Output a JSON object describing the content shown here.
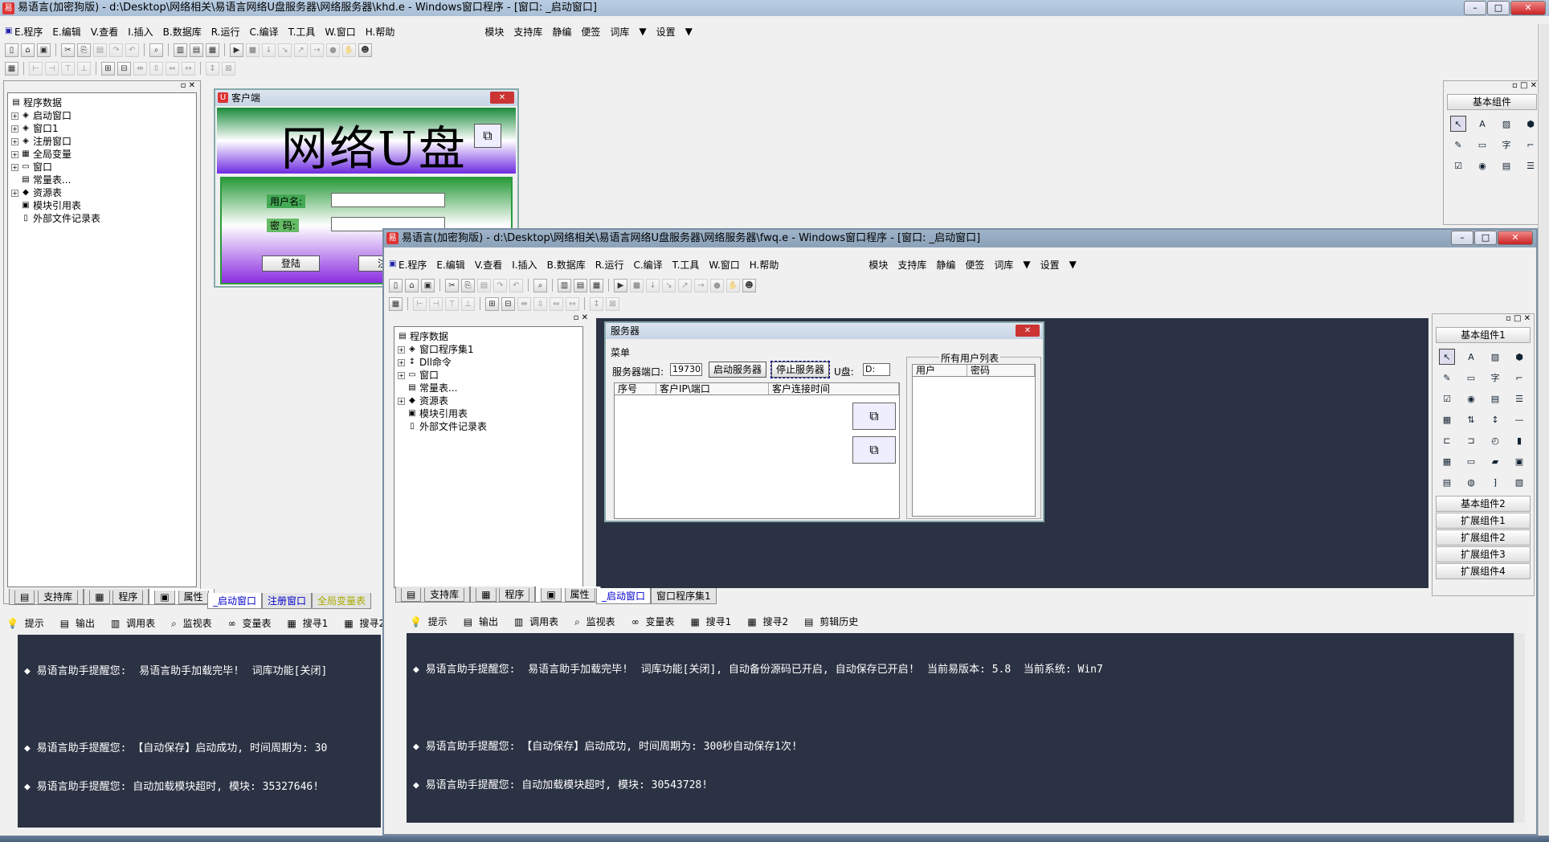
{
  "main_window": {
    "title": "易语言(加密狗版) - d:\\Desktop\\网络相关\\易语言网络U盘服务器\\网络服务器\\khd.e - Windows窗口程序 - [窗口: _启动窗口]"
  },
  "menu": [
    "E.程序",
    "E.编辑",
    "V.查看",
    "I.插入",
    "B.数据库",
    "R.运行",
    "C.编译",
    "T.工具",
    "W.窗口",
    "H.帮助"
  ],
  "menu_extra": [
    "模块",
    "支持库",
    "静编",
    "便签",
    "词库",
    "设置"
  ],
  "tree_left": [
    "程序数据",
    "启动窗口",
    "窗口1",
    "注册窗口",
    "全局变量",
    "窗口",
    "常量表...",
    "资源表",
    "模块引用表",
    "外部文件记录表"
  ],
  "left_tabs": [
    "支持库",
    "程序",
    "属性"
  ],
  "doc_tabs_left": [
    "_启动窗口",
    "注册窗口",
    "全局变量表"
  ],
  "out_tabs": [
    "提示",
    "输出",
    "调用表",
    "监视表",
    "变量表",
    "搜寻1",
    "搜寻2",
    "剪辑历史"
  ],
  "left_output": [
    "◆ 易语言助手提醒您:  易语言助手加载完毕!  词库功能[关闭]",
    "",
    "◆ 易语言助手提醒您: 【自动保存】启动成功, 时间周期为: 30",
    "◆ 易语言助手提醒您: 自动加载模块超时, 模块: 35327646!"
  ],
  "client_form": {
    "title": "客户端",
    "banner": "网络U盘",
    "user_label": "用户名:",
    "pwd_label": "密 码:",
    "login": "登陆",
    "register": "注册"
  },
  "palette_top": {
    "title": "基本组件"
  },
  "second_window": {
    "title": "易语言(加密狗版) - d:\\Desktop\\网络相关\\易语言网络U盘服务器\\网络服务器\\fwq.e - Windows窗口程序 - [窗口: _启动窗口]"
  },
  "tree_right": [
    "程序数据",
    "窗口程序集1",
    "Dll命令",
    "窗口",
    "常量表...",
    "资源表",
    "模块引用表",
    "外部文件记录表"
  ],
  "right_tabs": [
    "支持库",
    "程序",
    "属性"
  ],
  "doc_tabs_right": [
    "_启动窗口",
    "窗口程序集1"
  ],
  "server_form": {
    "title": "服务器",
    "menu": "菜单",
    "port_label": "服务器端口:",
    "port_value": "19730",
    "start": "启动服务器",
    "stop": "停止服务器",
    "udisk_label": "U盘:",
    "udisk_value": "D:",
    "cols": [
      "序号",
      "客户IP\\端口",
      "客户连接时间"
    ],
    "users_title": "所有用户列表",
    "user_cols": [
      "用户",
      "密码"
    ]
  },
  "palette_right": {
    "title": "基本组件1",
    "groups": [
      "基本组件2",
      "扩展组件1",
      "扩展组件2",
      "扩展组件3",
      "扩展组件4"
    ]
  },
  "right_output": [
    "◆ 易语言助手提醒您:  易语言助手加载完毕!  词库功能[关闭], 自动备份源码已开启, 自动保存已开启!  当前易版本: 5.8  当前系统: Win7",
    "",
    "◆ 易语言助手提醒您: 【自动保存】启动成功, 时间周期为: 300秒自动保存1次!",
    "◆ 易语言助手提醒您: 自动加载模块超时, 模块: 30543728!"
  ]
}
